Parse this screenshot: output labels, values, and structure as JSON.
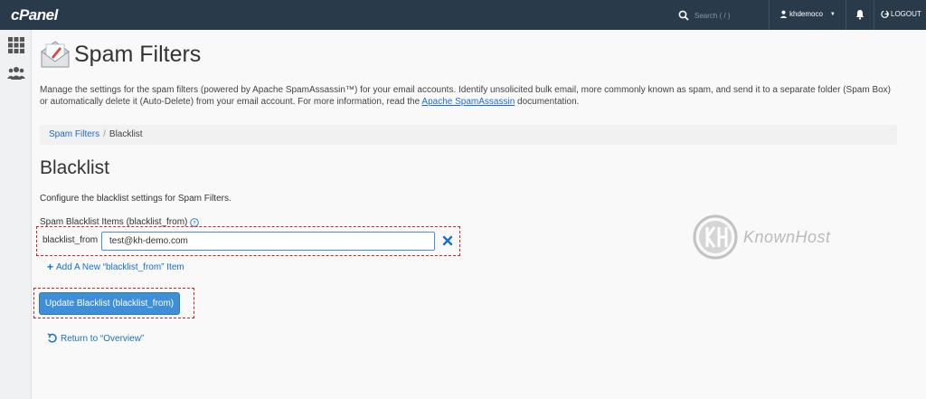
{
  "topbar": {
    "logo": "cPanel",
    "search_placeholder": "Search ( / )",
    "username": "khdemoco",
    "logout_label": "LOGOUT"
  },
  "page": {
    "title": "Spam Filters",
    "description_before_link": "Manage the settings for the spam filters (powered by Apache SpamAssassin™) for your email accounts. Identify unsolicited bulk email, more commonly known as spam, and send it to a separate folder (Spam Box) or automatically delete it (Auto-Delete) from your email account. For more information, read the ",
    "description_link": "Apache SpamAssassin",
    "description_after_link": " documentation."
  },
  "breadcrumb": {
    "parent": "Spam Filters",
    "separator": "/",
    "current": "Blacklist"
  },
  "section": {
    "title": "Blacklist",
    "configure_text": "Configure the blacklist settings for Spam Filters.",
    "items_label": "Spam Blacklist Items (blacklist_from)",
    "field_label": "blacklist_from",
    "field_value": "test@kh-demo.com",
    "add_link": "Add A New “blacklist_from” Item",
    "update_button": "Update Blacklist (blacklist_from)",
    "return_link": "Return to “Overview”"
  },
  "watermark": {
    "text": "KnownHost"
  },
  "colors": {
    "topbar": "#293a4a",
    "accent": "#3d8fd8",
    "link": "#1a6ec9",
    "highlight": "#c62828"
  }
}
